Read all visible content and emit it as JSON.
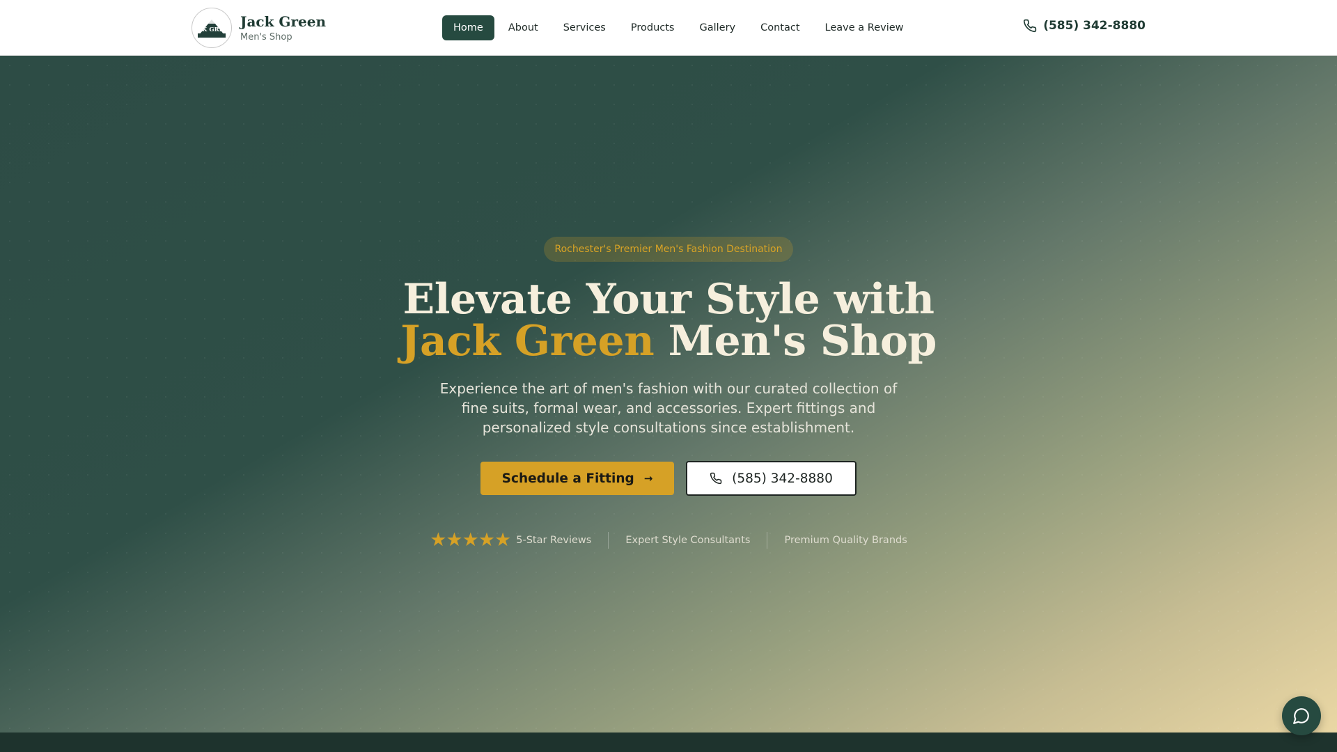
{
  "brand": {
    "name": "Jack Green",
    "subtitle": "Men's Shop",
    "logo_text": "JACK GREEN"
  },
  "nav": {
    "items": [
      {
        "label": "Home",
        "active": true
      },
      {
        "label": "About",
        "active": false
      },
      {
        "label": "Services",
        "active": false
      },
      {
        "label": "Products",
        "active": false
      },
      {
        "label": "Gallery",
        "active": false
      },
      {
        "label": "Contact",
        "active": false
      },
      {
        "label": "Leave a Review",
        "active": false
      }
    ]
  },
  "header": {
    "phone": "(585) 342-8880"
  },
  "hero": {
    "badge": "Rochester's Premier Men's Fashion Destination",
    "headline_line1": "Elevate Your Style with",
    "headline_accent": "Jack Green",
    "headline_rest": "Men's Shop",
    "subtext": "Experience the art of men's fashion with our curated collection of fine suits, formal wear, and accessories. Expert fittings and personalized style consultations since establishment.",
    "cta_primary": "Schedule a Fitting",
    "cta_primary_arrow": "→",
    "cta_phone": "(585) 342-8880"
  },
  "trust": {
    "stars": "★★★★★",
    "rating": 5,
    "reviews_label": "5-Star Reviews",
    "consultants_label": "Expert Style Consultants",
    "brands_label": "Premium Quality Brands"
  },
  "icons": {
    "phone": "phone-icon",
    "arrow": "arrow-right-icon",
    "chat": "chat-bubble-icon",
    "star": "star-icon"
  },
  "colors": {
    "primary_green": "#264a40",
    "accent_gold": "#d6a126",
    "headline_cream": "#f6efdd",
    "footer_dark": "#1e332d"
  }
}
